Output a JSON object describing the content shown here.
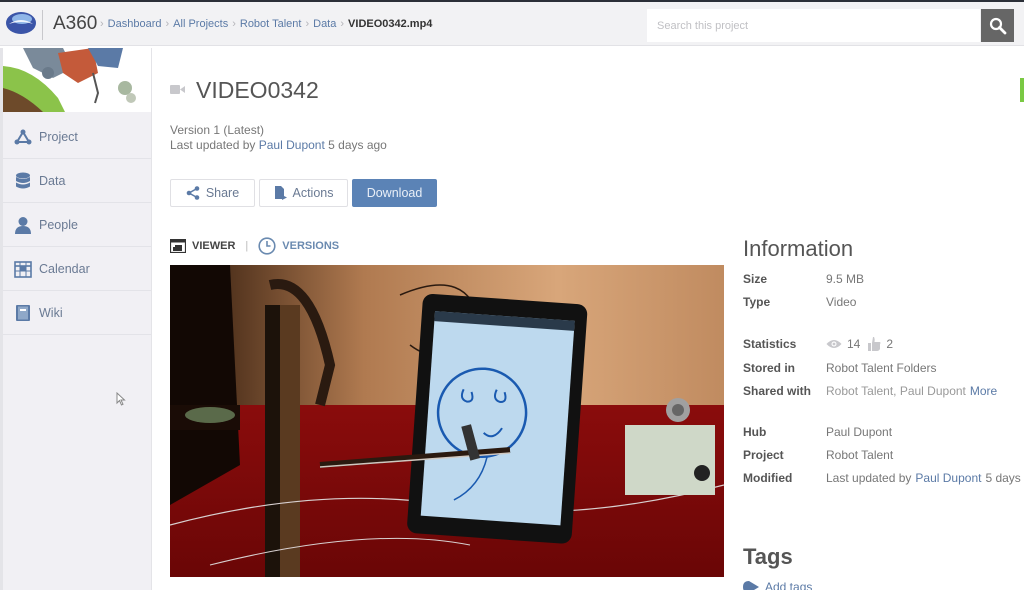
{
  "header": {
    "app_title": "A360",
    "breadcrumb": [
      "Dashboard",
      "All Projects",
      "Robot Talent",
      "Data"
    ],
    "breadcrumb_current": "VIDEO0342.mp4",
    "search_placeholder": "Search this project",
    "search_icon": "search-icon"
  },
  "sidebar": {
    "items": [
      {
        "label": "Project",
        "icon": "project-triangle-icon"
      },
      {
        "label": "Data",
        "icon": "database-icon"
      },
      {
        "label": "People",
        "icon": "person-icon"
      },
      {
        "label": "Calendar",
        "icon": "calendar-icon"
      },
      {
        "label": "Wiki",
        "icon": "book-icon"
      }
    ]
  },
  "file": {
    "title": "VIDEO0342",
    "version": "Version 1 (Latest)",
    "updated_prefix": "Last updated by",
    "updated_by": "Paul Dupont",
    "updated_when": "5 days ago"
  },
  "actions": {
    "share_label": "Share",
    "actions_label": "Actions",
    "download_label": "Download"
  },
  "tabs": {
    "viewer": "VIEWER",
    "versions": "VERSIONS"
  },
  "info": {
    "title": "Information",
    "size_label": "Size",
    "size": "9.5 MB",
    "type_label": "Type",
    "type": "Video",
    "statistics_label": "Statistics",
    "views": "14",
    "likes": "2",
    "stored_label": "Stored in",
    "stored_in": "Robot Talent Folders",
    "shared_label": "Shared with",
    "shared_with": "Robot Talent, Paul Dupont",
    "shared_more": "More",
    "hub_label": "Hub",
    "hub": "Paul Dupont",
    "project_label": "Project",
    "project": "Robot Talent",
    "modified_label": "Modified",
    "modified_prefix": "Last updated by",
    "modified_by": "Paul Dupont",
    "modified_when": "5 days"
  },
  "tags": {
    "title": "Tags",
    "add_label": "Add tags"
  },
  "colors": {
    "accent": "#5b83b6",
    "link": "#5b7aa6",
    "search_button": "#666666",
    "indicator": "#7ac943"
  }
}
